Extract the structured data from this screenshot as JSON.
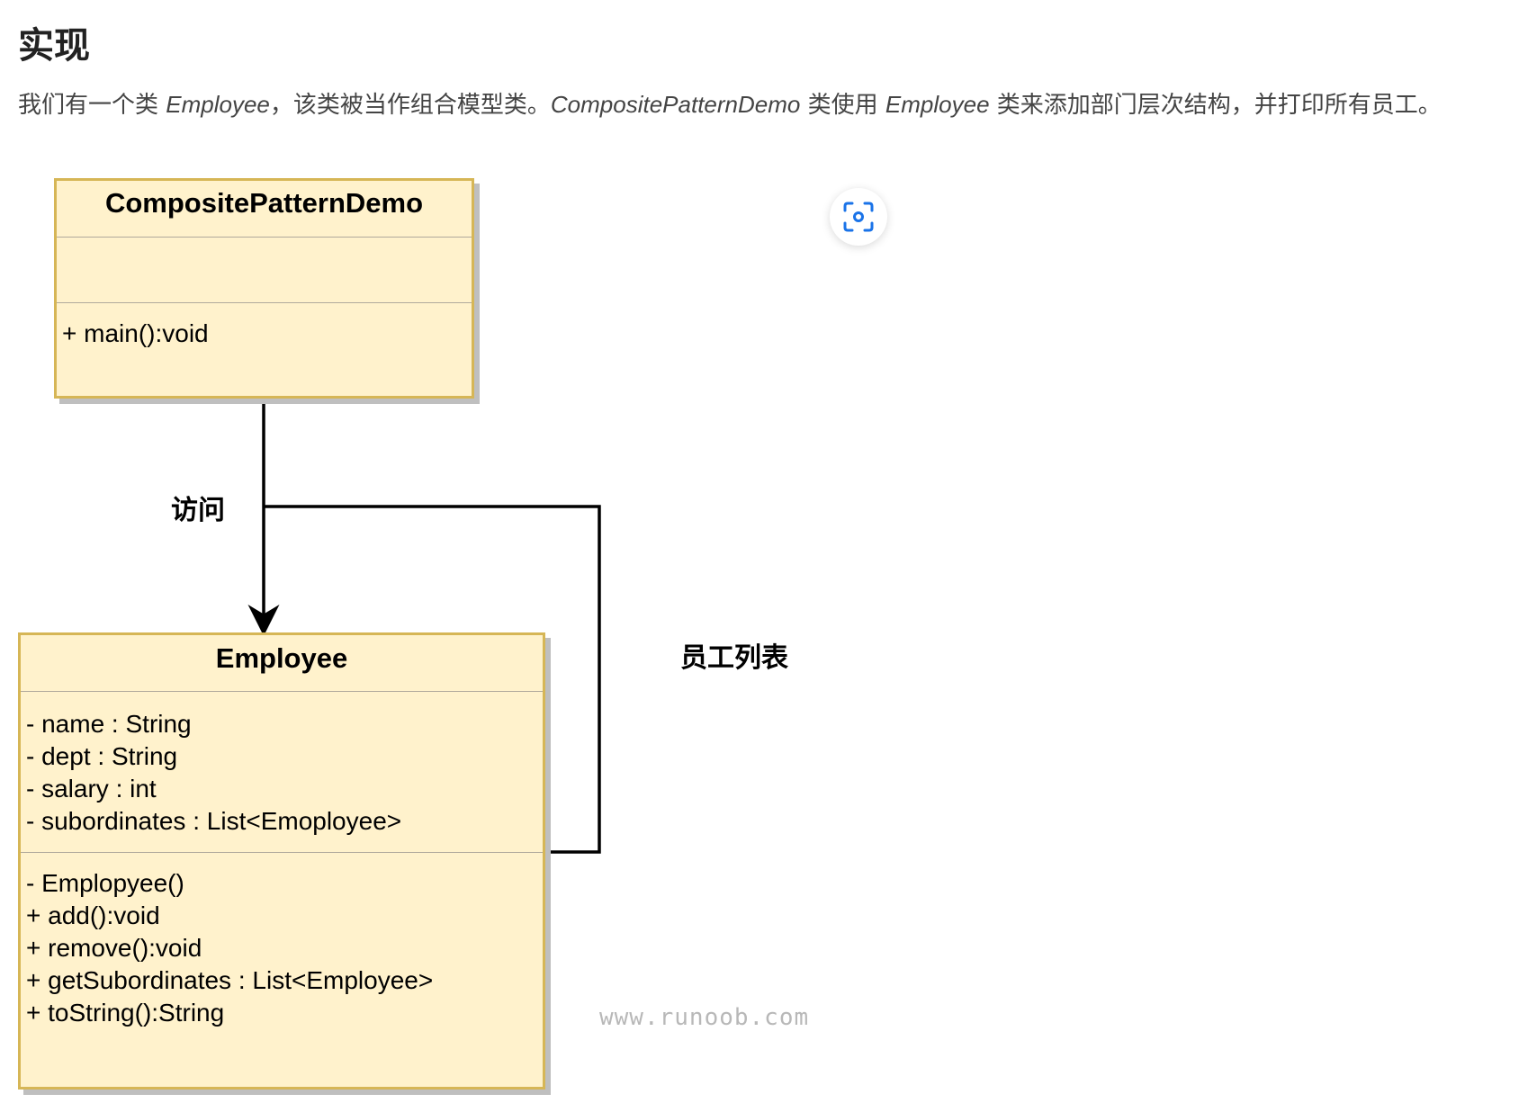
{
  "heading": "实现",
  "intro": {
    "part1": "我们有一个类 ",
    "em1": "Employee",
    "part2": "，该类被当作组合模型类。",
    "em2": "CompositePatternDemo",
    "part3": " 类使用 ",
    "em3": "Employee",
    "part4": " 类来添加部门层次结构，并打印所有员工。"
  },
  "diagram": {
    "demo_class": {
      "name": "CompositePatternDemo",
      "attributes": [],
      "methods": [
        "+ main():void"
      ]
    },
    "employee_class": {
      "name": "Employee",
      "attributes": [
        "- name : String",
        "- dept : String",
        "- salary : int",
        "- subordinates : List<Emoployee>"
      ],
      "methods": [
        "- Emplopyee()",
        "+ add():void",
        "+ remove():void",
        "+ getSubordinates : List<Employee>",
        "+ toString():String"
      ]
    },
    "relation_access_label": "访问",
    "relation_list_label": "员工列表",
    "watermark": "www.runoob.com"
  },
  "colors": {
    "class_fill": "#fff2cc",
    "class_border": "#d6b656",
    "scan_icon": "#1a73e8"
  },
  "icons": {
    "scan_button": "scan-icon"
  }
}
